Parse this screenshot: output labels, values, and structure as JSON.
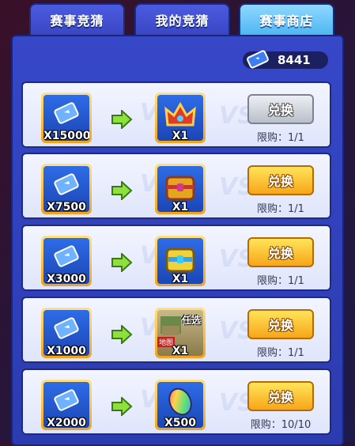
{
  "tabs": [
    {
      "label": "赛事竞猜",
      "active": false
    },
    {
      "label": "我的竞猜",
      "active": false
    },
    {
      "label": "赛事商店",
      "active": true
    }
  ],
  "currency": {
    "icon": "ticket-icon",
    "amount": "8441"
  },
  "rows": [
    {
      "cost": "X15000",
      "reward_icon": "crown-icon",
      "reward_qty": "X1",
      "button": "兑换",
      "button_state": "disabled",
      "limit": "限购：1/1"
    },
    {
      "cost": "X7500",
      "reward_icon": "gold-chest-icon",
      "reward_qty": "X1",
      "button": "兑换",
      "button_state": "enabled",
      "limit": "限购：1/1"
    },
    {
      "cost": "X3000",
      "reward_icon": "blue-chest-icon",
      "reward_qty": "X1",
      "button": "兑换",
      "button_state": "enabled",
      "limit": "限购：1/1"
    },
    {
      "cost": "X1000",
      "reward_icon": "map-pack-icon",
      "reward_qty": "X1",
      "reward_tag": "任选",
      "reward_tag2": "地图",
      "button": "兑换",
      "button_state": "enabled",
      "limit": "限购：1/1"
    },
    {
      "cost": "X2000",
      "reward_icon": "rainbow-bean-icon",
      "reward_qty": "X500",
      "button": "兑换",
      "button_state": "enabled",
      "limit": "限购：10/10"
    }
  ]
}
